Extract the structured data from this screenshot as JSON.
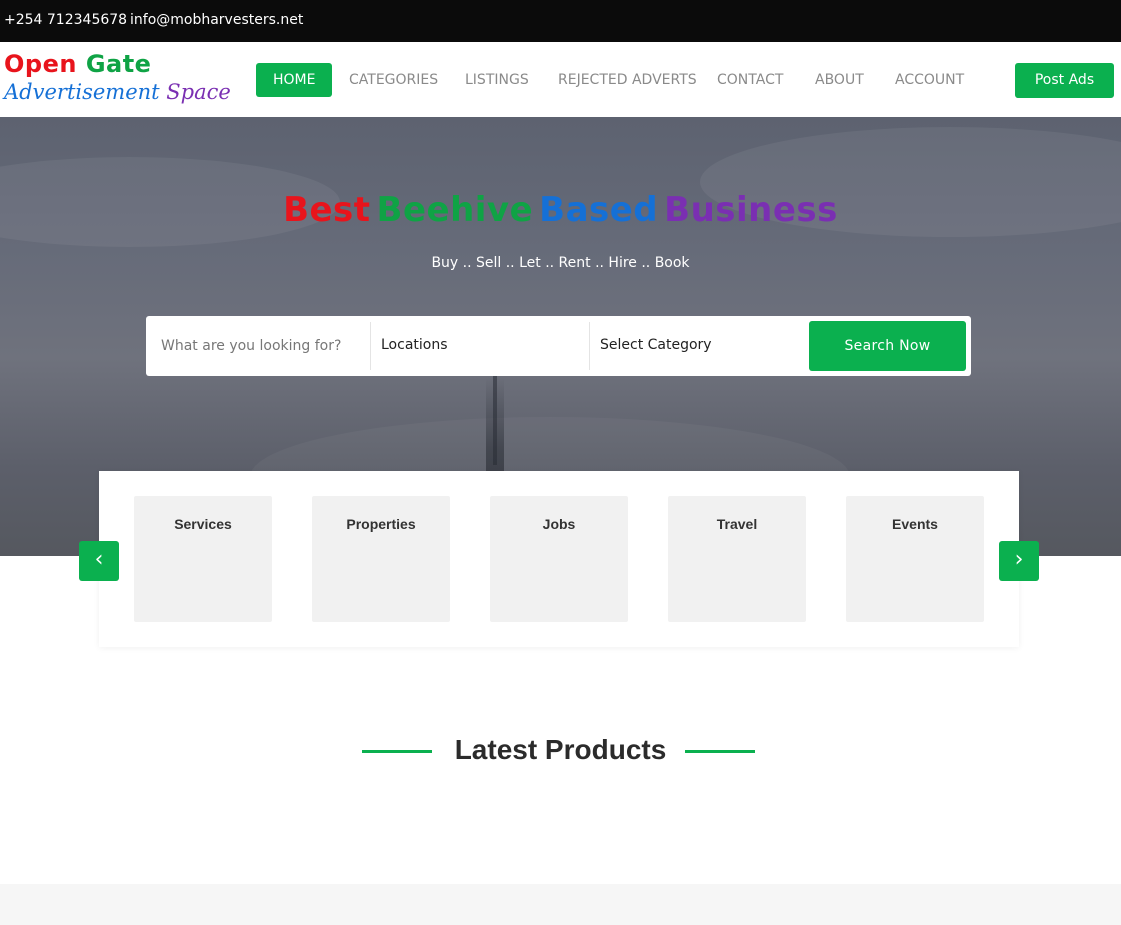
{
  "topbar": {
    "phone": "+254 712345678",
    "email": "info@mobharvesters.net"
  },
  "logo": {
    "word1": "Open",
    "word2": "Gate",
    "line2_part1": "Advertisement",
    "line2_part2": "Space"
  },
  "nav": {
    "items": [
      {
        "label": "HOME",
        "active": true
      },
      {
        "label": "CATEGORIES",
        "active": false
      },
      {
        "label": "LISTINGS",
        "active": false
      },
      {
        "label": "REJECTED ADVERTS",
        "active": false
      },
      {
        "label": "CONTACT",
        "active": false
      },
      {
        "label": "ABOUT",
        "active": false
      },
      {
        "label": "ACCOUNT",
        "active": false
      }
    ],
    "post_ads": "Post Ads"
  },
  "hero": {
    "title_words": [
      "Best",
      "Beehive",
      "Based",
      "Business"
    ],
    "subtitle": "Buy .. Sell .. Let .. Rent .. Hire .. Book"
  },
  "search": {
    "placeholder": "What are you looking for?",
    "location": "Locations",
    "category": "Select Category",
    "button": "Search Now"
  },
  "categories": {
    "items": [
      "Services",
      "Properties",
      "Jobs",
      "Travel",
      "Events"
    ],
    "prev_icon": "chevron-left-icon",
    "next_icon": "chevron-right-icon"
  },
  "latest_products": {
    "title": "Latest Products"
  },
  "colors": {
    "accent": "#0bb04f",
    "red": "#e8141c",
    "green": "#0fa345",
    "blue": "#1570d6",
    "purple": "#7a2fb2"
  }
}
